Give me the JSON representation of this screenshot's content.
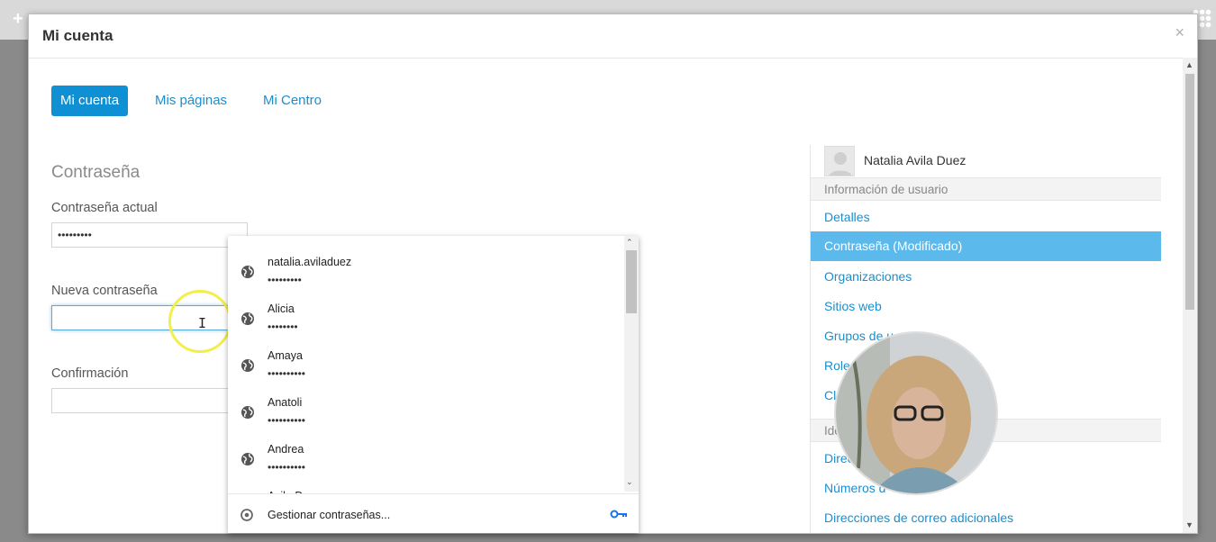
{
  "modal": {
    "title": "Mi cuenta",
    "close_symbol": "×"
  },
  "tabs": [
    {
      "label": "Mi cuenta",
      "active": true
    },
    {
      "label": "Mis páginas",
      "active": false
    },
    {
      "label": "Mi Centro",
      "active": false
    }
  ],
  "form": {
    "section_title": "Contraseña",
    "current_label": "Contraseña actual",
    "current_value": "•••••••••",
    "new_label": "Nueva contraseña",
    "new_value": "",
    "confirm_label": "Confirmación",
    "confirm_value": ""
  },
  "password_dropdown": {
    "entries": [
      {
        "user": "natalia.aviladuez",
        "mask": "•••••••••"
      },
      {
        "user": "Alicia",
        "mask": "••••••••"
      },
      {
        "user": "Amaya",
        "mask": "••••••••••"
      },
      {
        "user": "Anatoli",
        "mask": "••••••••••"
      },
      {
        "user": "Andrea",
        "mask": "••••••••••"
      },
      {
        "user": "Avila Duez",
        "mask": ""
      }
    ],
    "footer_label": "Gestionar contraseñas...",
    "icons": {
      "entry": "globe-icon",
      "footer": "chrome-icon",
      "key": "key-icon"
    }
  },
  "sidebar": {
    "user_name": "Natalia Avila Duez",
    "section1_header": "Información de usuario",
    "section1_items": [
      {
        "label": "Detalles",
        "active": false
      },
      {
        "label": "Contraseña (Modificado)",
        "active": true
      },
      {
        "label": "Organizaciones",
        "active": false
      },
      {
        "label": "Sitios web",
        "active": false
      },
      {
        "label": "Grupos de u",
        "active": false
      },
      {
        "label": "Role",
        "active": false
      },
      {
        "label": "Cla",
        "active": false
      }
    ],
    "section2_header": "Ide",
    "section2_items": [
      {
        "label": "Direc",
        "active": false
      },
      {
        "label": "Números d",
        "active": false
      },
      {
        "label": "Direcciones de correo adicionales",
        "active": false
      }
    ]
  },
  "colors": {
    "primary": "#0f8fd4",
    "link": "#1b8fcf",
    "active_nav": "#5bb9ec",
    "cursor_highlight": "#f2ee4a"
  }
}
